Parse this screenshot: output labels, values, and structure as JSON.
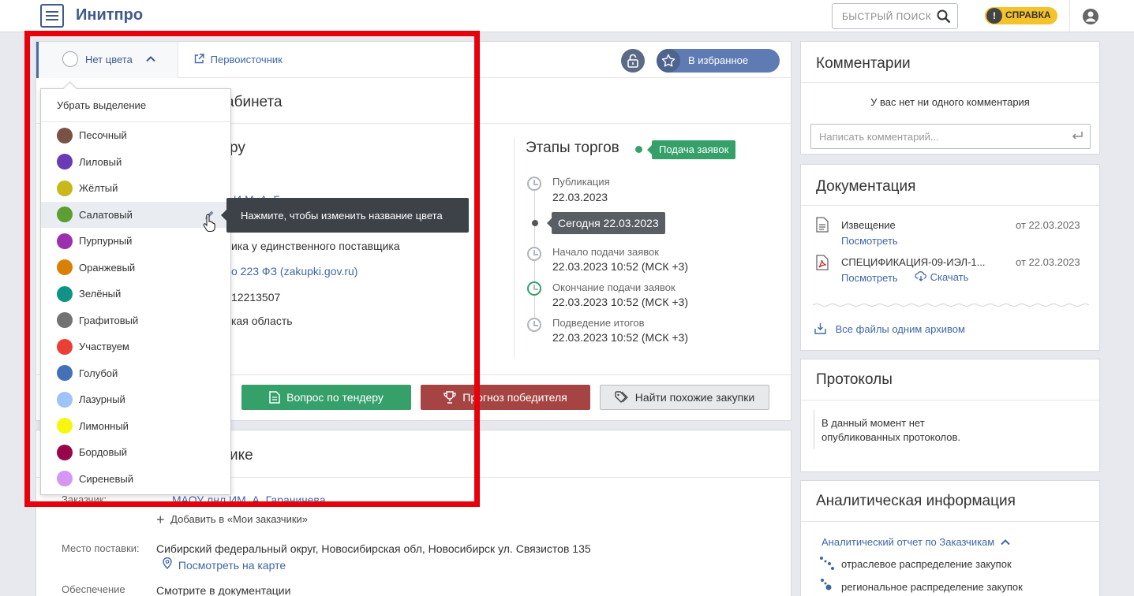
{
  "app": {
    "title": "Инитпро",
    "search_placeholder": "БЫСТРЫЙ ПОИСК",
    "help_label": "СПРАВКА"
  },
  "toolbar": {
    "color_label": "Нет цвета",
    "source_link": "Первоисточник",
    "favorite_label": "В избранное"
  },
  "header_fragment": "абинета",
  "info_fragments": [
    "ру",
    "И.М. А. Г",
    "ика у единственного поставщика",
    "о 223 ФЗ (zakupki.gov.ru)",
    "12213507",
    "кая область"
  ],
  "stages": {
    "title": "Этапы торгов",
    "badge": "Подача заявок",
    "today": "Сегодня 22.03.2023",
    "items": [
      {
        "label": "Публикация",
        "value": "22.03.2023"
      },
      {
        "label": "Начало подачи заявок",
        "value": "22.03.2023 10:52 (МСК +3)"
      },
      {
        "label": "Окончание подачи заявок",
        "value": "22.03.2023 10:52 (МСК +3)"
      },
      {
        "label": "Подведение итогов",
        "value": "22.03.2023 10:52 (МСК +3)"
      }
    ]
  },
  "actions": {
    "question": "Вопрос по тендеру",
    "forecast": "Прогноз победителя",
    "similar": "Найти похожие закупки"
  },
  "customer": {
    "header_fragment": "ике",
    "customer_label": "Заказчик:",
    "customer_value": "МАОУ лнл ИМ. А. Гараничева",
    "add_label": "Добавить в «Мои заказчики»",
    "delivery_label": "Место поставки:",
    "delivery_value": "Сибирский федеральный округ, Новосибирская обл, Новосибирск ул. Связистов 135",
    "map_link": "Посмотреть на карте",
    "security_label": "Обеспечение",
    "security_value": "Смотрите в документации"
  },
  "dropdown": {
    "clear": "Убрать выделение",
    "items": [
      {
        "label": "Песочный",
        "color": "#7b5144"
      },
      {
        "label": "Лиловый",
        "color": "#6a3bb5"
      },
      {
        "label": "Жёлтый",
        "color": "#c7b81c"
      },
      {
        "label": "Салатовый",
        "color": "#5c9e2f"
      },
      {
        "label": "Пурпурный",
        "color": "#9c2eb0"
      },
      {
        "label": "Оранжевый",
        "color": "#d98105"
      },
      {
        "label": "Зелёный",
        "color": "#0f9384"
      },
      {
        "label": "Графитовый",
        "color": "#727272"
      },
      {
        "label": "Участвуем",
        "color": "#ea3f35"
      },
      {
        "label": "Голубой",
        "color": "#4371b8"
      },
      {
        "label": "Лазурный",
        "color": "#9ec3f7"
      },
      {
        "label": "Лимонный",
        "color": "#f6f60e"
      },
      {
        "label": "Бордовый",
        "color": "#98064a"
      },
      {
        "label": "Сиреневый",
        "color": "#d498f4"
      }
    ],
    "tooltip": "Нажмите, чтобы изменить название цвета"
  },
  "comments": {
    "title": "Комментарии",
    "empty": "У вас нет ни одного комментария",
    "placeholder": "Написать комментарий..."
  },
  "docs": {
    "title": "Документация",
    "items": [
      {
        "name": "Извещение",
        "date": "от 22.03.2023",
        "view": "Посмотреть"
      },
      {
        "name": "СПЕЦИФИКАЦИЯ-09-ИЭЛ-1...",
        "date": "от 22.03.2023",
        "view": "Посмотреть",
        "download": "Скачать"
      }
    ],
    "archive": "Все файлы одним архивом"
  },
  "protocols": {
    "title": "Протоколы",
    "empty_line1": "В данный момент нет",
    "empty_line2": "опубликованных протоколов."
  },
  "analytics": {
    "title": "Аналитическая информация",
    "report": "Аналитический отчет по Заказчикам",
    "items": [
      "отраслевое распределение закупок",
      "региональное распределение закупок"
    ]
  }
}
